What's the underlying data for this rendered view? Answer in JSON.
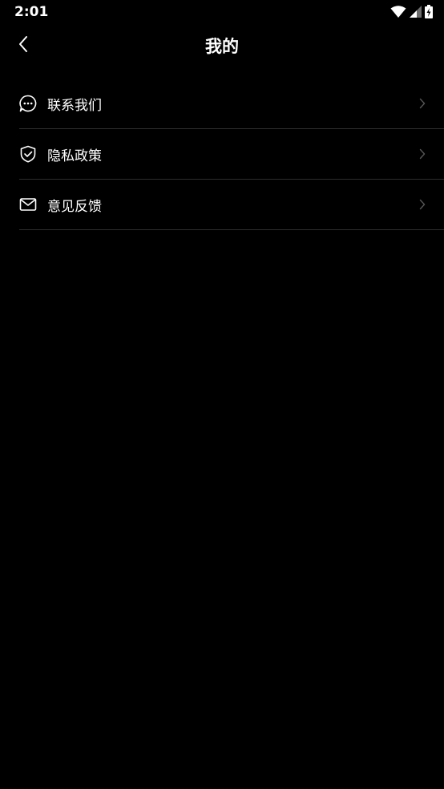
{
  "status_bar": {
    "time": "2:01",
    "icons": [
      "wifi-icon",
      "cellular-signal-icon",
      "battery-charging-icon"
    ]
  },
  "header": {
    "title": "我的",
    "back_icon": "chevron-left-icon"
  },
  "menu": {
    "items": [
      {
        "label": "联系我们",
        "icon": "chat-bubble-icon"
      },
      {
        "label": "隐私政策",
        "icon": "shield-check-icon"
      },
      {
        "label": "意见反馈",
        "icon": "envelope-icon"
      }
    ],
    "chevron_icon": "chevron-right-icon"
  },
  "colors": {
    "background": "#000000",
    "text": "#ffffff",
    "divider": "#2e2e2e",
    "chevron": "#555555"
  }
}
